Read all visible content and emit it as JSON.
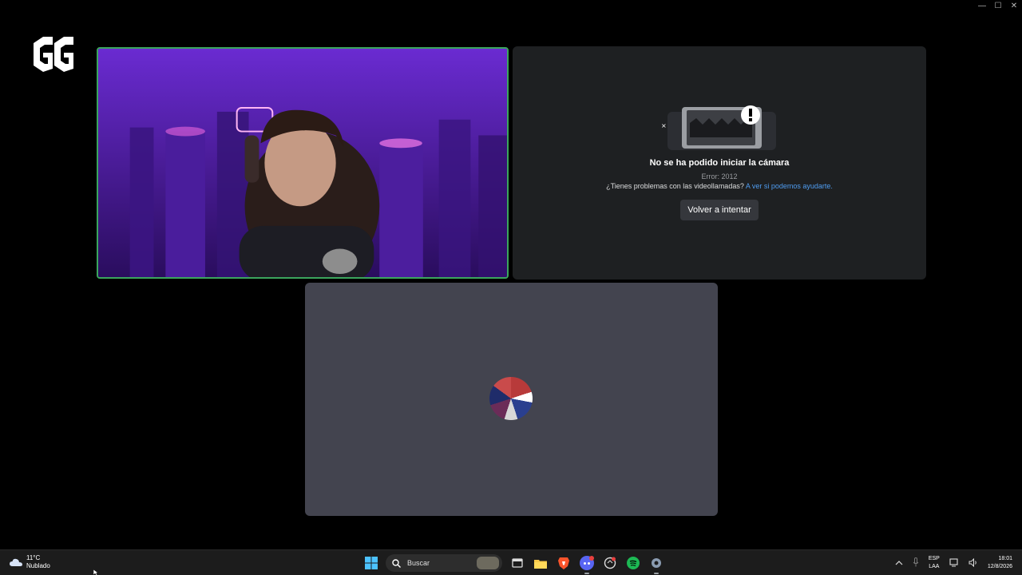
{
  "window": {
    "controls": [
      "—",
      "☐",
      "✕"
    ]
  },
  "logo": {
    "text": "GG"
  },
  "error_tile": {
    "title": "No se ha podido iniciar la cámara",
    "code": "Error: 2012",
    "help_text": "¿Tienes problemas con las videollamadas?",
    "help_link": "A ver si podemos ayudarte.",
    "retry_label": "Volver a intentar"
  },
  "taskbar": {
    "weather_temp": "11°C",
    "weather_desc": "Nublado",
    "search_placeholder": "Buscar",
    "lang_line1": "ESP",
    "lang_line2": "LAA",
    "time": "18:01",
    "date": "12/8/2026"
  },
  "colors": {
    "speaking_border": "#3ba55d",
    "link": "#4f9cf0",
    "tile_dark": "#1e2022",
    "tile_avatar": "#43444f"
  },
  "icons": [
    "windows-start-icon",
    "search-icon",
    "task-view-icon",
    "file-explorer-icon",
    "brave-icon",
    "discord-icon",
    "game-icon",
    "spotify-icon",
    "settings-icon",
    "chevron-up-icon",
    "microphone-icon",
    "network-icon",
    "volume-icon"
  ]
}
